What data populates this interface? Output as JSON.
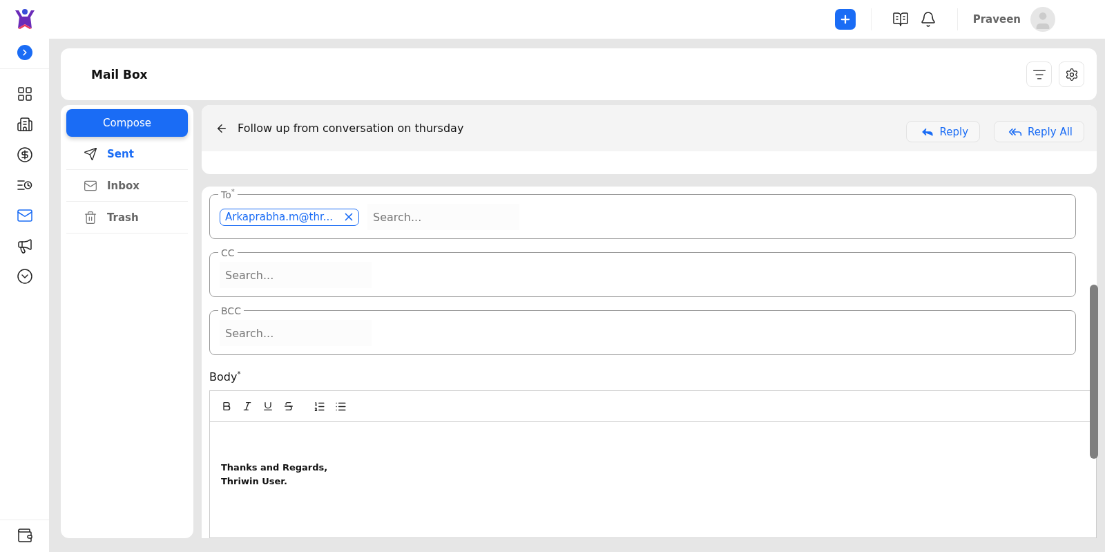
{
  "top_bar": {
    "user_name": "Praveen"
  },
  "nav_rail": {
    "items": [
      {
        "selected": false
      },
      {
        "selected": false
      },
      {
        "selected": false
      },
      {
        "selected": false
      },
      {
        "selected": true
      },
      {
        "selected": false
      },
      {
        "selected": false
      }
    ]
  },
  "header": {
    "title": "Mail Box"
  },
  "folders": {
    "compose": "Compose",
    "items": [
      {
        "label": "Sent",
        "selected": true
      },
      {
        "label": "Inbox",
        "selected": false
      },
      {
        "label": "Trash",
        "selected": false
      }
    ]
  },
  "thread": {
    "subject": "Follow up from conversation on thursday",
    "actions": [
      "Reply",
      "Reply All"
    ]
  },
  "recipients": [
    {
      "label": "To",
      "required_mark": "*",
      "chips": [
        "Arkaprabha.m@thr..."
      ],
      "placeholder": "Search..."
    },
    {
      "label": "CC",
      "placeholder": "Search..."
    },
    {
      "label": "BCC",
      "placeholder": "Search..."
    }
  ],
  "body": {
    "label": "Body",
    "required_mark": "*",
    "lines": [
      "Thanks and Regards,",
      "Thriwin User."
    ]
  }
}
